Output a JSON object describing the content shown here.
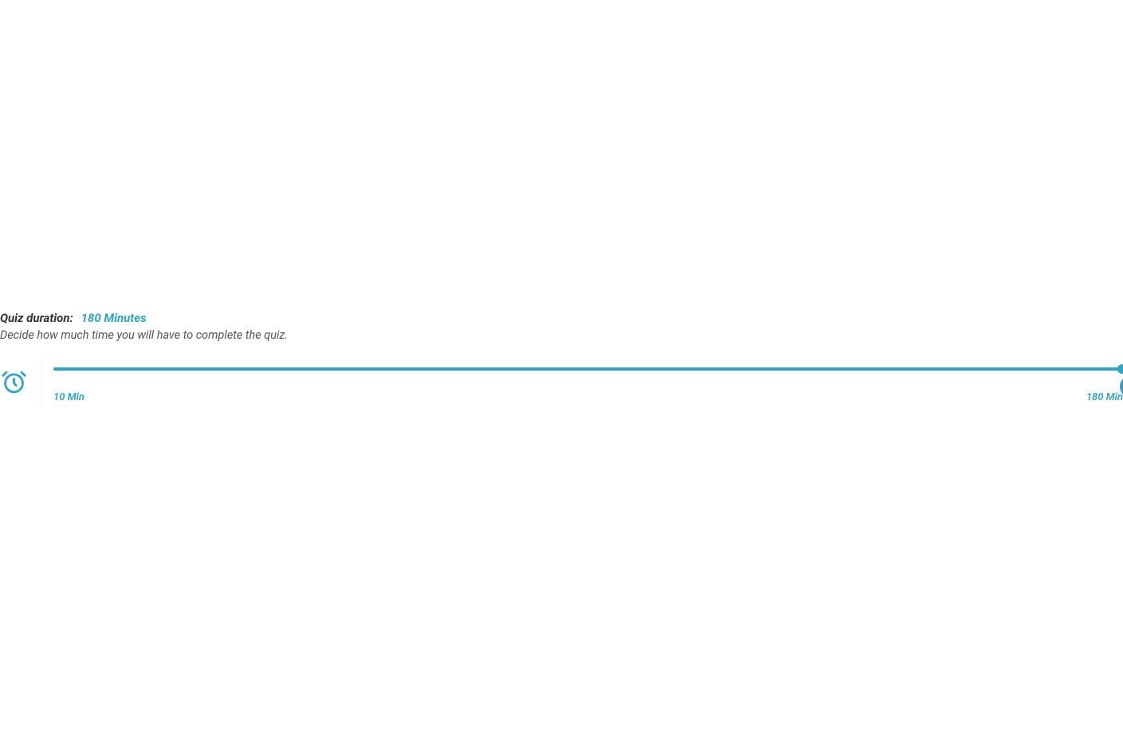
{
  "duration": {
    "label": "Quiz duration:",
    "value": "180 Minutes",
    "description": "Decide how much time you will have to complete the quiz."
  },
  "slider": {
    "min_label": "10 Min",
    "max_label": "180 Min",
    "min": 10,
    "max": 180,
    "current": 180
  },
  "colors": {
    "accent": "#2ca5c3"
  }
}
